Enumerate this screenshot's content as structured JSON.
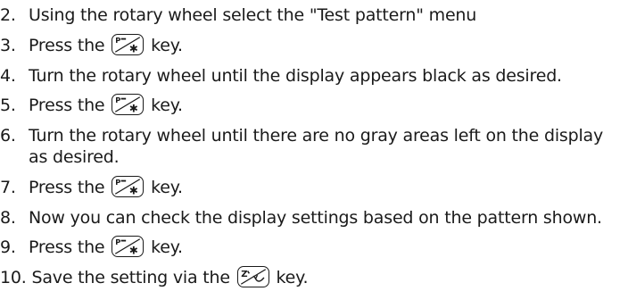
{
  "steps": [
    {
      "number": "2.",
      "text": "Using the rotary wheel select the \"Test pattern\" menu"
    },
    {
      "number": "3.",
      "before": "Press the ",
      "key": "program-key",
      "after": " key."
    },
    {
      "number": "4.",
      "text": "Turn the rotary wheel until the display appears black as desired."
    },
    {
      "number": "5.",
      "before": "Press the ",
      "key": "program-key",
      "after": " key."
    },
    {
      "number": "6.",
      "text": "Turn the rotary wheel until there are no gray areas left on the display",
      "text2": "as desired."
    },
    {
      "number": "7.",
      "before": "Press the ",
      "key": "program-key",
      "after": " key."
    },
    {
      "number": "8.",
      "text": "Now you can check the display settings based on the pattern shown."
    },
    {
      "number": "9.",
      "before": "Press the ",
      "key": "program-key",
      "after": " key."
    },
    {
      "number": "10.",
      "before": "Save the setting via the ",
      "key": "zero-key",
      "after": " key."
    }
  ],
  "icons": {
    "program_key": "program-star-key-icon",
    "zero_key": "zero-check-key-icon"
  }
}
